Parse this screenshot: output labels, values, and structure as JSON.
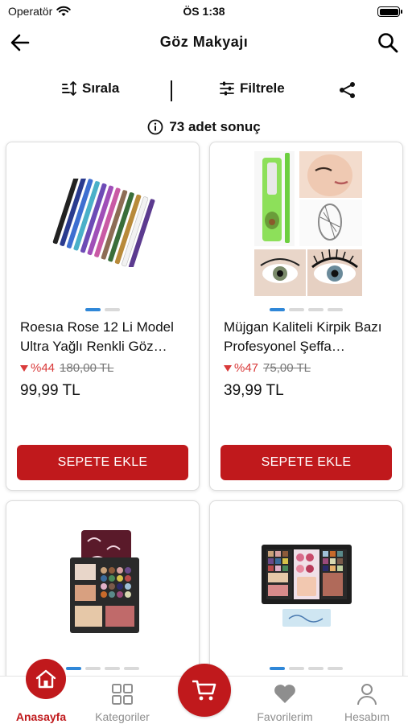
{
  "status_bar": {
    "carrier": "Operatör",
    "time": "ÖS 1:38"
  },
  "header": {
    "title": "Göz Makyajı",
    "back_icon": "arrow-left-icon",
    "search_icon": "search-icon"
  },
  "toolbar": {
    "sort_label": "Sırala",
    "filter_label": "Filtrele",
    "share_icon": "share-icon"
  },
  "results": {
    "count_text": "73 adet sonuç"
  },
  "products": [
    {
      "name": "Roesıa Rose 12 Li Model Ultra Yağlı Renkli Göz…",
      "discount": "%44",
      "old_price": "180,00 TL",
      "price": "99,99 TL",
      "add_label": "SEPETE EKLE",
      "image": "eyeliner-pencils",
      "image_count": 2,
      "active_image": 0
    },
    {
      "name": "Müjgan Kaliteli Kirpik Bazı Profesyonel Şeffa…",
      "discount": "%47",
      "old_price": "75,00 TL",
      "price": "39,99 TL",
      "add_label": "SEPETE EKLE",
      "image": "lash-primer-collage",
      "image_count": 4,
      "active_image": 0
    },
    {
      "name": "",
      "image": "makeup-palette-kit",
      "image_count": 4,
      "active_image": 0
    },
    {
      "name": "",
      "image": "eyeshadow-palette-set",
      "image_count": 4,
      "active_image": 0
    }
  ],
  "tabbar": {
    "items": [
      {
        "label": "Anasayfa",
        "icon": "home-icon",
        "active": true
      },
      {
        "label": "Kategoriler",
        "icon": "grid-icon",
        "active": false
      },
      {
        "label": "",
        "icon": "cart-icon",
        "active": false
      },
      {
        "label": "Favorilerim",
        "icon": "heart-icon",
        "active": false
      },
      {
        "label": "Hesabım",
        "icon": "user-icon",
        "active": false
      }
    ]
  },
  "colors": {
    "brand_red": "#c0191c",
    "discount_red": "#d93a3a",
    "carousel_active": "#2f87d8",
    "muted_gray": "#8e8e8e"
  }
}
